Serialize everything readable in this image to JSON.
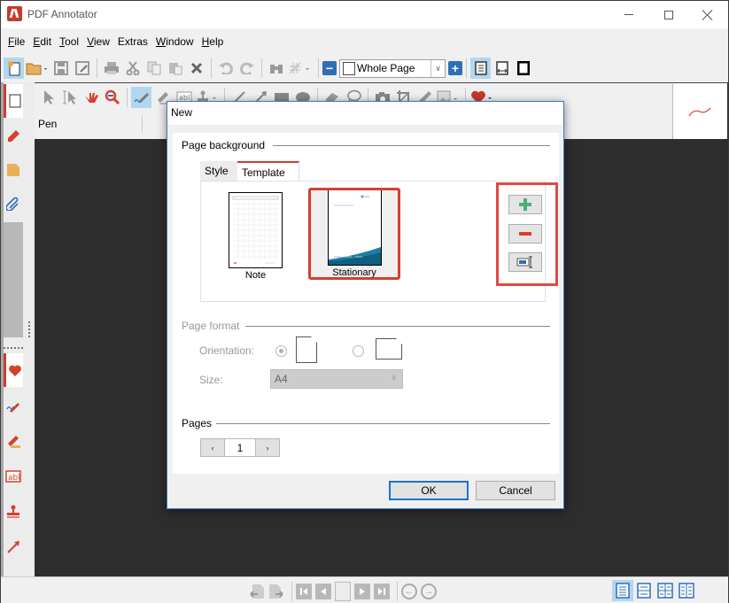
{
  "window": {
    "title": "PDF Annotator",
    "controls": {
      "minimize": "minimize",
      "maximize": "maximize",
      "close": "close"
    }
  },
  "menubar": {
    "items": [
      {
        "label": "File",
        "accel": "F",
        "rest": "ile"
      },
      {
        "label": "Edit",
        "accel": "E",
        "rest": "dit"
      },
      {
        "label": "Tool",
        "accel": "T",
        "rest": "ool"
      },
      {
        "label": "View",
        "accel": "V",
        "rest": "iew"
      },
      {
        "label": "Extras",
        "accel": "",
        "rest": "Extras"
      },
      {
        "label": "Window",
        "accel": "W",
        "rest": "indow"
      },
      {
        "label": "Help",
        "accel": "H",
        "rest": "elp"
      }
    ]
  },
  "toolbar": {
    "zoom_value": "Whole Page",
    "icons": [
      "new-document-icon",
      "open-folder-icon",
      "save-icon",
      "save-as-icon",
      "print-icon",
      "cut-icon",
      "copy-icon",
      "paste-icon",
      "delete-icon",
      "undo-icon",
      "redo-icon",
      "find-icon",
      "grid-icon",
      "zoom-out-icon",
      "zoom-in-icon",
      "fit-page-icon",
      "fit-width-icon",
      "fullscreen-icon"
    ]
  },
  "tool_toolbar": {
    "active_tool_label": "Pen",
    "icons": [
      "select-icon",
      "text-select-icon",
      "hand-icon",
      "zoom-tool-icon",
      "pen-icon",
      "highlighter-icon",
      "text-box-icon",
      "stamp-icon",
      "line-icon",
      "arrow-icon",
      "rectangle-icon",
      "ellipse-icon",
      "eraser-icon",
      "lasso-icon",
      "camera-icon",
      "crop-icon",
      "ruler-icon",
      "image-icon",
      "favorite-heart-icon"
    ]
  },
  "sidebar": {
    "top_tabs": [
      "pages-icon",
      "annotations-icon",
      "document-icon",
      "attachments-icon"
    ],
    "bottom_tabs": [
      "favorites-heart-icon",
      "pen-tool-icon",
      "highlighter-tool-icon",
      "textbox-tool-icon",
      "stamp-tool-icon",
      "arrow-tool-icon"
    ]
  },
  "statusbar": {
    "nav": [
      "back-document-icon",
      "forward-document-icon",
      "first-page-icon",
      "prev-page-icon",
      "page-field",
      "next-page-icon",
      "last-page-icon",
      "history-back-icon",
      "history-forward-icon"
    ],
    "views": [
      "single-page-view-icon",
      "continuous-view-icon",
      "two-page-view-icon",
      "two-page-continuous-view-icon"
    ]
  },
  "dialog": {
    "title": "New",
    "page_background": {
      "heading": "Page background",
      "tabs": [
        {
          "label": "Style",
          "active": false
        },
        {
          "label": "Template",
          "active": true
        }
      ],
      "templates": [
        {
          "label": "Note",
          "selected": false
        },
        {
          "label": "Stationary",
          "selected": true
        }
      ],
      "actions": [
        "add-template",
        "remove-template",
        "rename-template"
      ]
    },
    "page_format": {
      "heading": "Page format",
      "orientation_label": "Orientation:",
      "orientation_options": [
        "portrait",
        "landscape"
      ],
      "orientation_selected": "portrait",
      "size_label": "Size:",
      "size_value": "A4"
    },
    "pages": {
      "heading": "Pages",
      "value": "1",
      "prev": "‹",
      "next": "›"
    },
    "buttons": {
      "ok": "OK",
      "cancel": "Cancel"
    }
  },
  "colors": {
    "accent_red": "#d5402f",
    "highlight_red": "#e04a42",
    "accent_blue": "#2e6fb8",
    "add_green": "#4caf7a"
  }
}
